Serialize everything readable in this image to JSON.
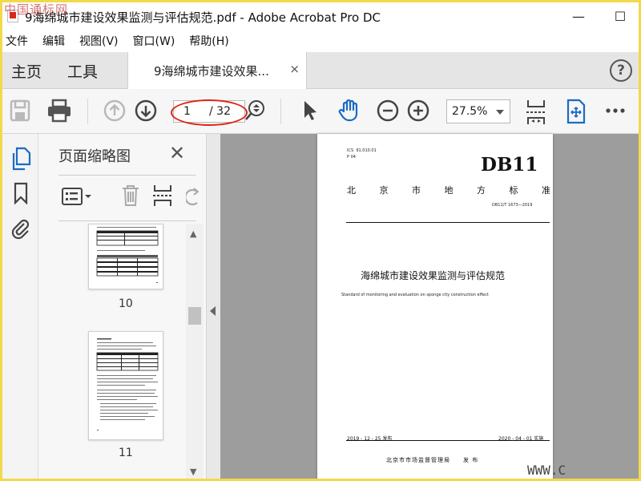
{
  "watermark": "中国通标网",
  "window": {
    "title": "9海绵城市建设效果监测与评估规范.pdf - Adobe Acrobat Pro DC",
    "minimize": "—",
    "maximize": "☐"
  },
  "menu": [
    "文件",
    "编辑",
    "视图(V)",
    "窗口(W)",
    "帮助(H)"
  ],
  "tabs": {
    "home": "主页",
    "tools": "工具",
    "doc": "9海绵城市建设效果...",
    "close": "×",
    "help": "?"
  },
  "toolbar": {
    "current_page": "1",
    "total_pages": "/ 32",
    "zoom": "27.5%"
  },
  "panel": {
    "title": "页面缩略图",
    "close": "✕"
  },
  "thumbnails": [
    {
      "label": "10"
    },
    {
      "label": "11"
    }
  ],
  "document": {
    "ics": "ICS  91.010.01\nP 04",
    "code": "DB11",
    "region": [
      "北",
      "京",
      "市",
      "地",
      "方",
      "标",
      "准"
    ],
    "std_no": "DB11/T 1673—2019",
    "cn_title": "海绵城市建设效果监测与评估规范",
    "en_title": "Standard of monitoring and evaluation on sponge city construction effect",
    "date_left": "2019 - 12 - 25 发布",
    "date_right": "2020 - 04 - 01 实施",
    "publisher": "北京市市场监督管理局　　发 布"
  },
  "bottom_watermark": "WWW.C",
  "colors": {
    "accent": "#1a6bc4",
    "highlight": "#e0231b",
    "doc_bg": "#9d9d9d"
  }
}
